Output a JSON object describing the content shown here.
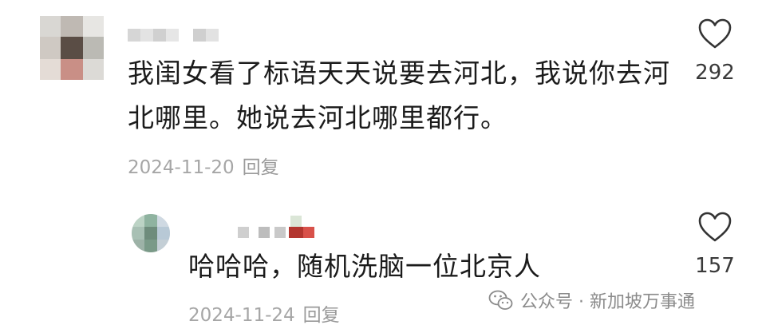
{
  "comments": [
    {
      "text": "我闺女看了标语天天说要去河北，我说你去河北哪里。她说去河北哪里都行。",
      "date": "2024-11-20",
      "reply_label": "回复",
      "likes": "292"
    },
    {
      "text": "哈哈哈，随机洗脑一位北京人",
      "date": "2024-11-24",
      "reply_label": "回复",
      "likes": "157"
    }
  ],
  "watermark": {
    "text": "公众号 · 新加坡万事通",
    "icon": "wechat-icon"
  },
  "colors": {
    "text": "#1b1b1b",
    "meta": "#a6a6a6",
    "count": "#3a3a3a",
    "background": "#ffffff"
  }
}
